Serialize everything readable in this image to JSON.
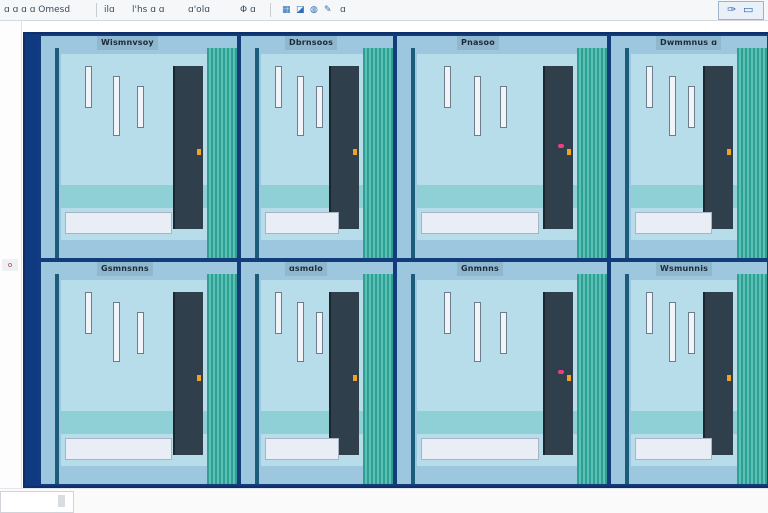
{
  "toolbar": {
    "items": [
      "ɑ ɑ ɑ ɑ Omesd",
      "ilɑ",
      "l'hs ɑ ɑ",
      "ɑ'olɑ",
      "Φ ɑ",
      "ɑ"
    ]
  },
  "rail": {
    "marker": "o"
  },
  "panels": [
    {
      "title": "Wismnvsoy"
    },
    {
      "title": "Dbrnsoos"
    },
    {
      "title": "Pnasoo"
    },
    {
      "title": "Dwmmnus ɑ"
    },
    {
      "title": "Gsmnsnns"
    },
    {
      "title": "ɑsmɑlo"
    },
    {
      "title": "Gnmnns"
    },
    {
      "title": "Wsmunnis"
    }
  ],
  "colors": {
    "frame": "#103a80",
    "panel_bg": "#9cc7de",
    "teal": "#2f9e93",
    "accent_pink": "#ee3d82",
    "accent_orange": "#f0a320"
  }
}
